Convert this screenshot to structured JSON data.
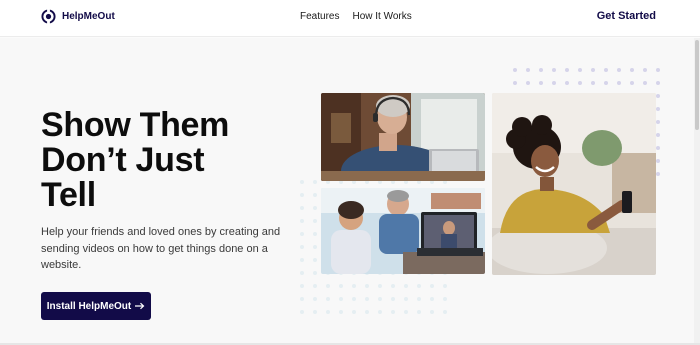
{
  "nav": {
    "logo_text": "HelpMeOut",
    "links": [
      {
        "label": "Features"
      },
      {
        "label": "How It Works"
      }
    ],
    "cta_label": "Get Started"
  },
  "hero": {
    "headline": [
      "Show Them",
      "Don’t Just",
      "Tell"
    ],
    "subtext": "Help your friends and loved ones by creating and sending videos on how to get things done on a website.",
    "button_label": "Install HelpMeOut",
    "button_icon": "arrow-right-icon"
  },
  "colors": {
    "brand": "#120b48",
    "dots": "#d6d4ea",
    "dots_faint": "#e5eef2"
  },
  "images": [
    {
      "name": "woman-with-headset-laptop"
    },
    {
      "name": "man-and-boy-video-call"
    },
    {
      "name": "woman-smiling-at-phone"
    }
  ]
}
